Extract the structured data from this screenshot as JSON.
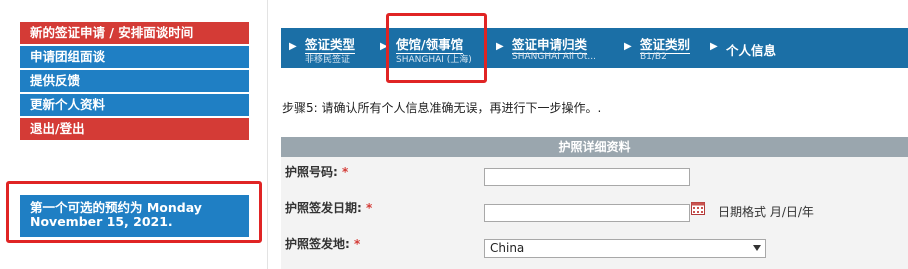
{
  "sidebar": {
    "items": [
      {
        "label": "新的签证申请 / 安排面谈时间",
        "color": "#d43b36"
      },
      {
        "label": "申请团组面谈",
        "color": "#1f7fc4"
      },
      {
        "label": "提供反馈",
        "color": "#1f7fc4"
      },
      {
        "label": "更新个人资料",
        "color": "#1f7fc4"
      },
      {
        "label": "退出/登出",
        "color": "#d43b36"
      }
    ],
    "availability": {
      "line1": "第一个可选的预约为 Monday",
      "line2": "November 15, 2021."
    }
  },
  "steps": [
    {
      "title": "签证类型",
      "sub": "非移民签证"
    },
    {
      "title": "使馆/领事馆",
      "sub": "SHANGHAI (上海)"
    },
    {
      "title": "签证申请归类",
      "sub": "SHANGHAI All Ot..."
    },
    {
      "title": "签证类别",
      "sub": "B1/B2"
    },
    {
      "title": "个人信息",
      "sub": ""
    }
  ],
  "instruction": "步骤5: 请确认所有个人信息准确无误，再进行下一步操作。.",
  "form": {
    "section_title": "护照详细资料",
    "required_mark": "*",
    "passport_number_label": "护照号码:",
    "passport_number_value": "",
    "issue_date_label": "护照签发日期:",
    "issue_date_value": "",
    "date_format_hint": "日期格式 月/日/年",
    "issue_place_label": "护照签发地:",
    "issue_place_value": "China"
  },
  "colors": {
    "accent_red": "#d43b36",
    "accent_blue": "#1f7fc4",
    "stepbar": "#1b6fa6",
    "highlight_box": "#e02424"
  },
  "icons": [
    "step-arrow-icon",
    "calendar-icon",
    "chevron-down-icon"
  ]
}
